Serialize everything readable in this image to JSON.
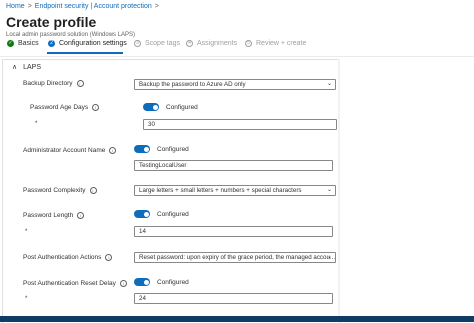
{
  "breadcrumb": {
    "home": "Home",
    "sep": ">",
    "section": "Endpoint security | Account protection",
    "trail_sep": ">"
  },
  "page": {
    "title": "Create profile",
    "subtitle": "Local admin password solution (Windows LAPS)"
  },
  "steps": [
    {
      "label": "Basics",
      "state": "done",
      "mark": "✓"
    },
    {
      "label": "Configuration settings",
      "state": "active",
      "mark": "2"
    },
    {
      "label": "Scope tags",
      "state": "todo",
      "mark": "3"
    },
    {
      "label": "Assignments",
      "state": "todo",
      "mark": "4"
    },
    {
      "label": "Review + create",
      "state": "todo",
      "mark": "5"
    }
  ],
  "section": {
    "title": "LAPS",
    "chevron": "∧"
  },
  "fields": {
    "backup_directory": {
      "label": "Backup Directory",
      "value": "Backup the password to Azure AD only"
    },
    "password_age_days": {
      "label": "Password Age Days",
      "toggle": "Configured",
      "required": "*",
      "value": "30"
    },
    "admin_account_name": {
      "label": "Administrator Account Name",
      "toggle": "Configured",
      "value": "TestingLocalUser"
    },
    "password_complexity": {
      "label": "Password Complexity",
      "value": "Large letters + small letters + numbers + special characters"
    },
    "password_length": {
      "label": "Password Length",
      "toggle": "Configured",
      "required": "*",
      "value": "14"
    },
    "post_auth_actions": {
      "label": "Post Authentication Actions",
      "value": "Reset password: upon expiry of the grace period, the managed accou..."
    },
    "post_auth_reset_delay": {
      "label": "Post Authentication Reset Delay",
      "toggle": "Configured",
      "required": "*",
      "value": "24"
    }
  },
  "icons": {
    "info": "info-icon",
    "dropdown": "chevron-down-icon"
  },
  "colors": {
    "accent": "#0f6cbd",
    "done": "#107c10",
    "bottom_bar": "#0f3c66"
  }
}
